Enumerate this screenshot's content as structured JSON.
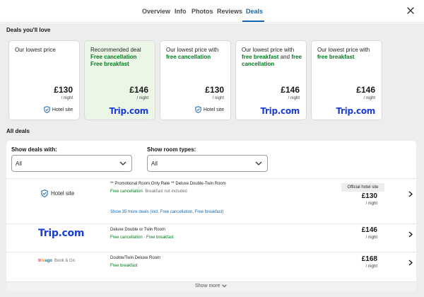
{
  "tabs": [
    {
      "label": "Overview"
    },
    {
      "label": "Info"
    },
    {
      "label": "Photos"
    },
    {
      "label": "Reviews"
    },
    {
      "label": "Deals",
      "active": true
    }
  ],
  "close_icon": "close-icon",
  "deals_you_love": {
    "title": "Deals you'll love",
    "cards": [
      {
        "desc_plain": "Our lowest price",
        "price": "£130",
        "per_night": "/ night",
        "provider": "Hotel site",
        "provider_icon": "shield-check-icon"
      },
      {
        "heading": "Recommended deal",
        "line1": "Free cancellation",
        "line2": "Free breakfast",
        "price": "£146",
        "per_night": "/ night",
        "provider": "Trip.com"
      },
      {
        "desc_plain": "Our lowest price with",
        "desc_green": "free cancellation",
        "price": "£130",
        "per_night": "/ night",
        "provider": "Hotel site",
        "provider_icon": "shield-check-icon"
      },
      {
        "desc_plain": "Our lowest price with",
        "desc_green": "free breakfast",
        "desc_and": "and",
        "desc_green2": "free cancellation",
        "price": "£146",
        "per_night": "/ night",
        "provider": "Trip.com"
      },
      {
        "desc_plain": "Our lowest price with",
        "desc_green": "free breakfast",
        "price": "£146",
        "per_night": "/ night",
        "provider": "Trip.com"
      }
    ]
  },
  "all_deals": {
    "title": "All deals",
    "filter_deals": {
      "label": "Show deals with:",
      "value": "All"
    },
    "filter_rooms": {
      "label": "Show room types:",
      "value": "All"
    },
    "rows": [
      {
        "provider": "Hotel site",
        "provider_icon": "shield-check-icon",
        "title": "** Promotional Room Only Rate ** Deluxe Double-Twin Room",
        "amen_green": "Free cancellation",
        "amen_gray": "· Breakfast not included",
        "show_more": "Show 35 more deals (incl. Free cancellation, Free breakfast)",
        "badge": "Official hotel site",
        "price": "£130",
        "per_night": "/ night"
      },
      {
        "provider": "Trip.com",
        "title": "Deluxe Double or Twin Room",
        "amen_green": "Free cancellation · Free breakfast",
        "price": "£146",
        "per_night": "/ night"
      },
      {
        "provider_brand": "trivago",
        "provider_suffix": "Book & Go",
        "title": "Double/Twin Deluxe Room",
        "amen_green": "Free breakfast",
        "price": "£168",
        "per_night": "/ night"
      }
    ],
    "show_more_label": "Show more"
  },
  "colors": {
    "accent": "#1668b0",
    "green": "#007a1f",
    "trip_blue": "#1b3cd6",
    "recommended_bg": "#ebf6e6"
  }
}
